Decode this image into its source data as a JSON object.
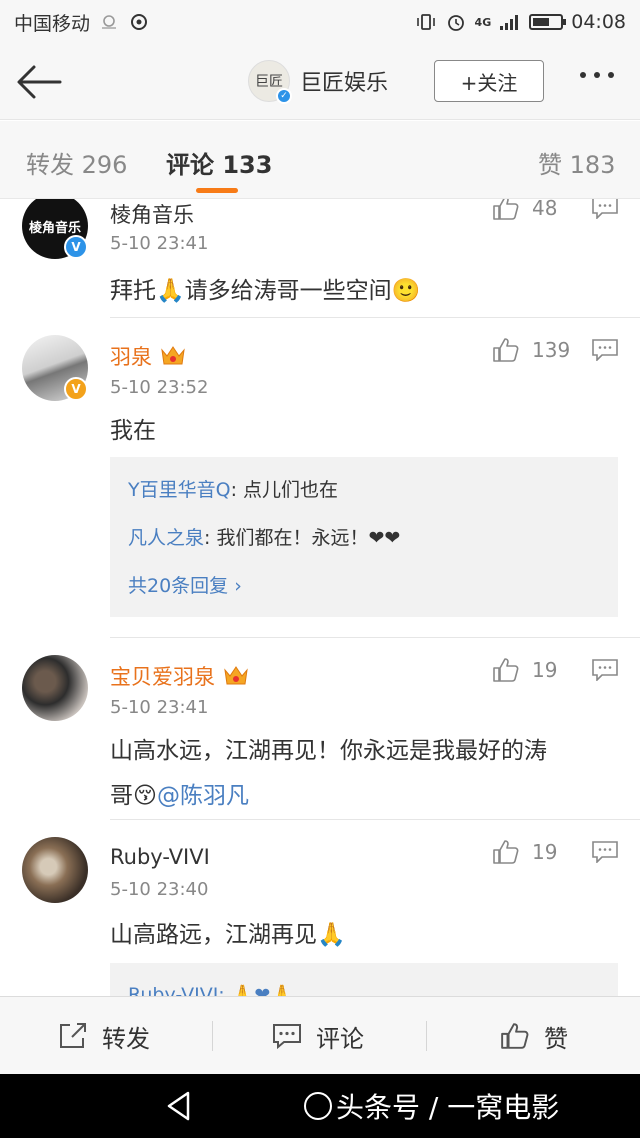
{
  "status_bar": {
    "carrier": "中国移动",
    "network": "4G",
    "time": "04:08",
    "battery_level": 0.6
  },
  "header": {
    "account_name": "巨匠娱乐",
    "account_avatar_text": "巨匠",
    "follow_label": "+关注"
  },
  "tabs": [
    {
      "label": "转发 296"
    },
    {
      "label": "评论 133"
    },
    {
      "label": "赞 183"
    }
  ],
  "comments": [
    {
      "name": "棱角音乐",
      "time": "5-10 23:41",
      "text": "拜托🙏请多给涛哥一些空间🙂",
      "likes": "48",
      "avatar_text": "棱角音乐",
      "badge": "V"
    },
    {
      "name": "羽泉",
      "time": "5-10 23:52",
      "text": "我在",
      "likes": "139",
      "badge": "V",
      "replies": [
        {
          "name": "Y百里华音Q",
          "text": ": 点儿们也在"
        },
        {
          "name": "凡人之泉",
          "text": ": 我们都在！永远！❤❤"
        }
      ],
      "more_replies": "共20条回复 ›"
    },
    {
      "name": "宝贝爱羽泉",
      "time": "5-10 23:41",
      "text_line1": "山高水远，江湖再见！你永远是我最好的涛",
      "text_line2": "哥😚",
      "mention": "@陈羽凡",
      "likes": "19"
    },
    {
      "name": "Ruby-VIVI",
      "time": "5-10 23:40",
      "text": "山高路远，江湖再见🙏",
      "likes": "19",
      "partial_reply": "Ruby-VIVI: 🙏❤🙏"
    }
  ],
  "action_bar": {
    "repost_label": "转发",
    "comment_label": "评论",
    "like_label": "赞"
  },
  "watermark": "头条号 / 一窝电影",
  "colors": {
    "accent_orange": "#f77b17",
    "link_blue": "#4a7fc1",
    "verified_blue": "#2d93e8",
    "verified_gold": "#f3a21b"
  }
}
